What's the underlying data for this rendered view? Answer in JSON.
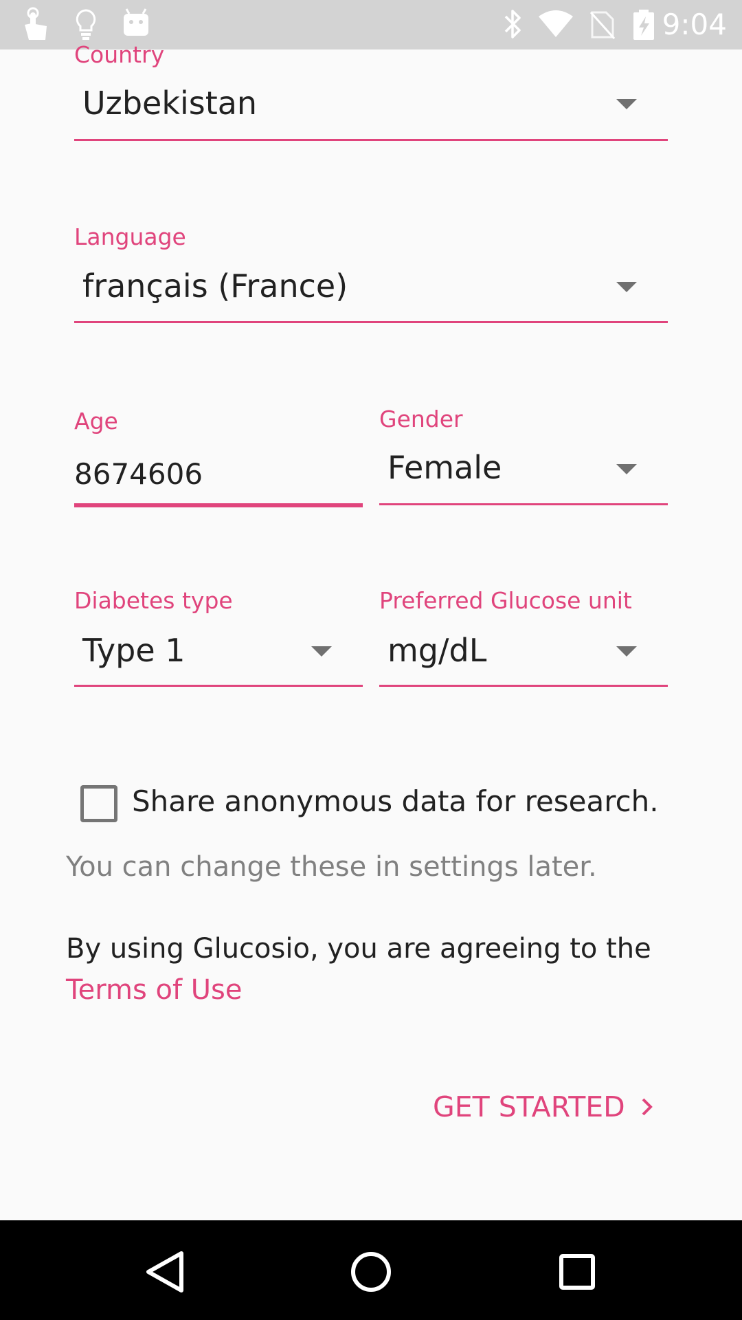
{
  "status_bar": {
    "time": "9:04",
    "left_icons": [
      "touch-icon",
      "bulb-icon",
      "android-icon"
    ],
    "right_icons": [
      "bluetooth-icon",
      "wifi-icon",
      "no-sim-icon",
      "battery-charging-icon"
    ]
  },
  "form": {
    "country": {
      "label": "Country",
      "value": "Uzbekistan"
    },
    "language": {
      "label": "Language",
      "value": "français (France)"
    },
    "age": {
      "label": "Age",
      "value": "8674606"
    },
    "gender": {
      "label": "Gender",
      "value": "Female"
    },
    "diabetes_type": {
      "label": "Diabetes type",
      "value": "Type 1"
    },
    "glucose_unit": {
      "label": "Preferred Glucose unit",
      "value": "mg/dL"
    },
    "share_data": {
      "label": "Share anonymous data for research.",
      "checked": false
    },
    "hint": "You can change these in settings later.",
    "terms_text": "By using Glucosio, you are agreeing to the",
    "terms_link": "Terms of Use"
  },
  "actions": {
    "get_started": "GET STARTED"
  },
  "nav_bar": {
    "buttons": [
      "back-icon",
      "home-icon",
      "recents-icon"
    ]
  },
  "colors": {
    "accent": "#e0447c",
    "background": "#fafafa",
    "status_bar": "#d3d3d3",
    "nav_bar": "#000000"
  }
}
